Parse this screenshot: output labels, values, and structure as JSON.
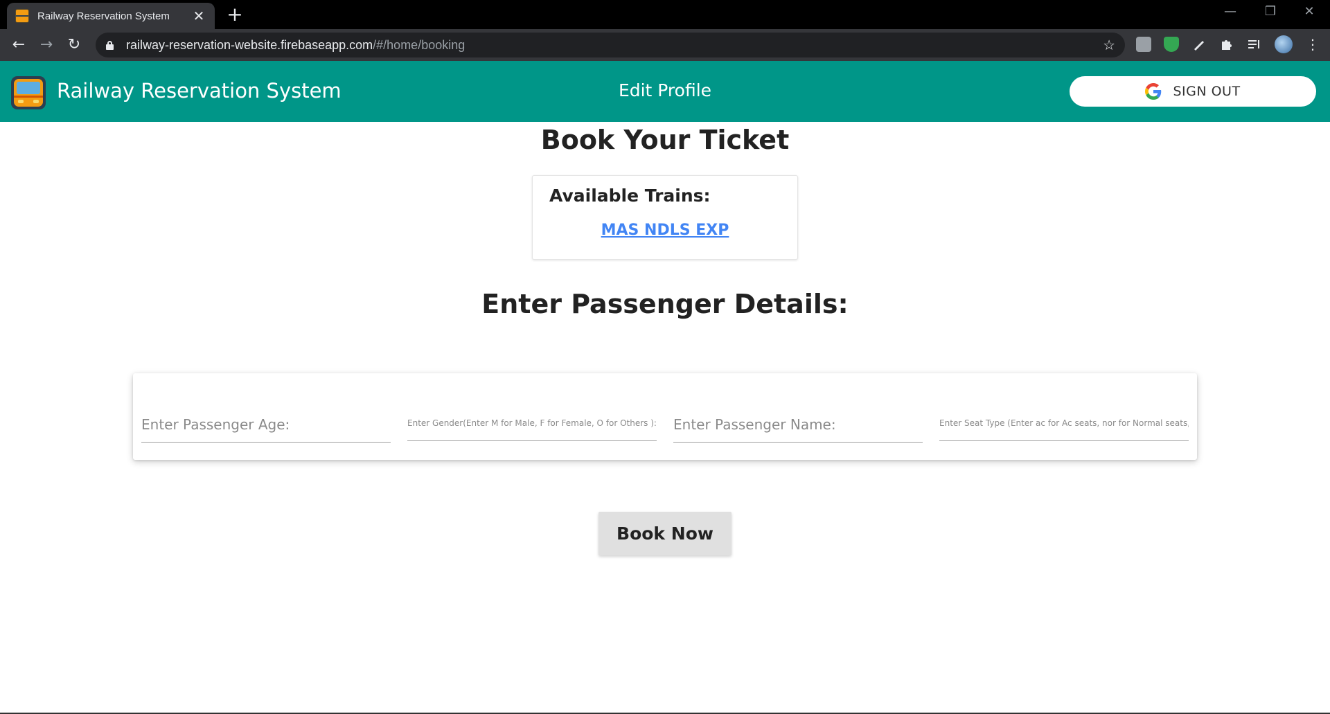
{
  "browser": {
    "tab_title": "Railway Reservation System",
    "url_host": "railway-reservation-website.firebaseapp.com",
    "url_path": "/#/home/booking",
    "tab_close_glyph": "✕",
    "new_tab_glyph": "+",
    "back_glyph": "←",
    "forward_glyph": "→",
    "reload_glyph": "↻",
    "star_glyph": "☆",
    "minimize_glyph": "—",
    "restore_glyph": "❐",
    "close_glyph": "✕"
  },
  "header": {
    "brand": "Railway Reservation System",
    "edit_profile": "Edit Profile",
    "sign_out": "SIGN OUT",
    "background_color": "#009688"
  },
  "booking": {
    "title": "Book Your Ticket",
    "trains_heading": "Available Trains:",
    "trains": [
      "MAS NDLS EXP"
    ],
    "passenger_heading": "Enter Passenger Details:",
    "fields": {
      "age_placeholder": "Enter Passenger Age:",
      "gender_placeholder": "Enter Gender(Enter M for Male, F for Female, O for Others ):",
      "name_placeholder": "Enter Passenger Name:",
      "seat_placeholder": "Enter Seat Type (Enter ac for Ac seats, nor for Normal seats,..."
    },
    "book_button": "Book Now"
  },
  "icons": {
    "logo": "train-logo-icon",
    "google": "google-icon",
    "lock": "lock-icon"
  }
}
